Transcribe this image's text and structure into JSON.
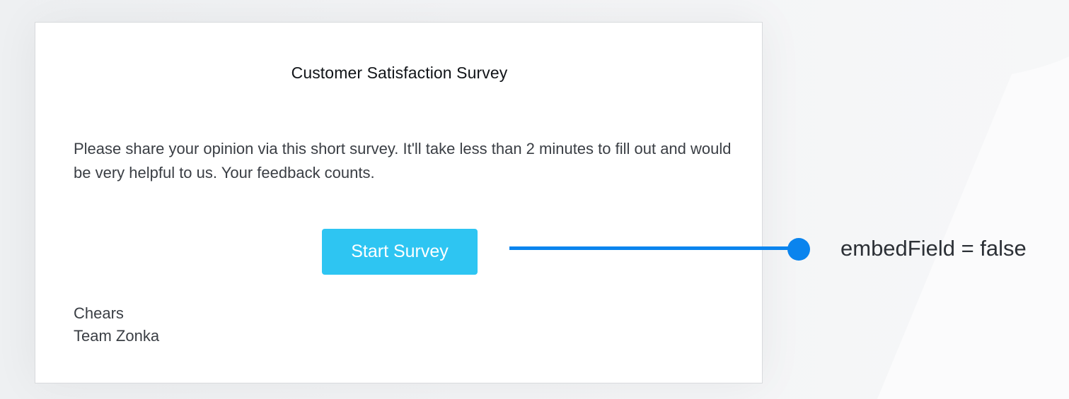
{
  "survey": {
    "title": "Customer Satisfaction Survey",
    "message": "Please share your opinion via this short survey. It'll take less than 2 minutes to fill out and would be very helpful to us. Your feedback counts.",
    "button_label": "Start Survey",
    "signoff_line1": "Chears",
    "signoff_line2": "Team Zonka"
  },
  "annotation": {
    "label": "embedField = false"
  },
  "colors": {
    "button": "#2ec5f2",
    "connector": "#0a84ee",
    "background": "#f3f4f6"
  }
}
